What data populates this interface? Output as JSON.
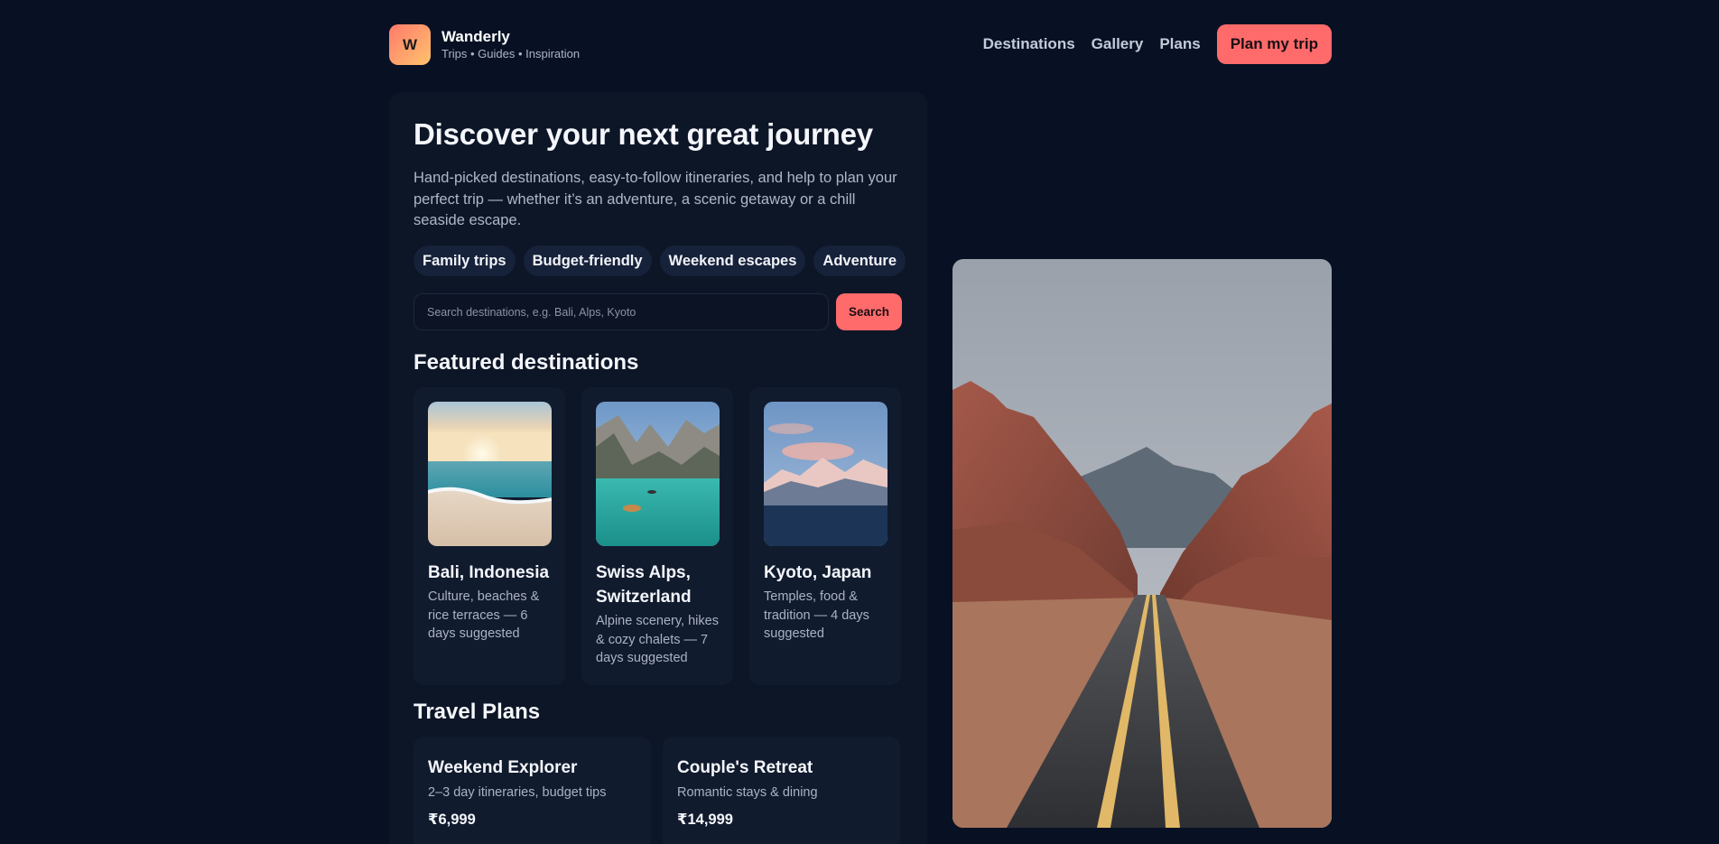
{
  "header": {
    "logo_letter": "W",
    "brand_name": "Wanderly",
    "tagline": "Trips • Guides • Inspiration",
    "nav": [
      "Destinations",
      "Gallery",
      "Plans"
    ],
    "cta": "Plan my trip"
  },
  "hero": {
    "title": "Discover your next great journey",
    "subtitle": "Hand-picked destinations, easy-to-follow itineraries, and help to plan your perfect trip — whether it’s an adventure, a scenic getaway or a chill seaside escape.",
    "chips": [
      "Family trips",
      "Budget-friendly",
      "Weekend escapes",
      "Adventure"
    ]
  },
  "search": {
    "placeholder": "Search destinations, e.g. Bali, Alps, Kyoto",
    "value": "",
    "button": "Search"
  },
  "featured": {
    "title": "Featured destinations",
    "items": [
      {
        "name": "Bali, Indonesia",
        "desc": "Culture, beaches & rice terraces — 6 days suggested",
        "image": "beach-sunset"
      },
      {
        "name": "Swiss Alps, Switzerland",
        "desc": "Alpine scenery, hikes & cozy chalets — 7 days suggested",
        "image": "alpine-lake"
      },
      {
        "name": "Kyoto, Japan",
        "desc": "Temples, food & tradition — 4 days suggested",
        "image": "snowy-mountains"
      }
    ]
  },
  "plans": {
    "title": "Travel Plans",
    "items": [
      {
        "name": "Weekend Explorer",
        "desc": "2–3 day itineraries, budget tips",
        "price": "₹6,999"
      },
      {
        "name": "Couple's Retreat",
        "desc": "Romantic stays & dining",
        "price": "₹14,999"
      }
    ]
  },
  "colors": {
    "background": "#081124",
    "panel": "#0d1627",
    "accent": "#ff6b6b",
    "logo_gradient": [
      "#ff7a6b",
      "#ffc36d"
    ]
  },
  "side_image": "desert-road"
}
